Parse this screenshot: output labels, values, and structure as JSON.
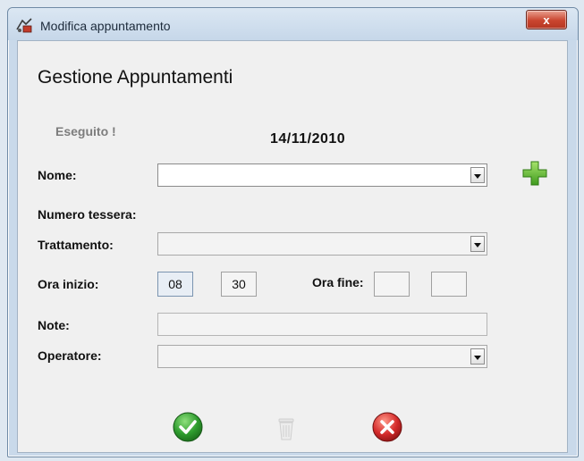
{
  "window": {
    "title": "Modifica appuntamento",
    "close_label": "x"
  },
  "header": {
    "title": "Gestione Appuntamenti"
  },
  "status": {
    "text": "Eseguito !"
  },
  "date": "14/11/2010",
  "form": {
    "nome_label": "Nome:",
    "nome_value": "",
    "numero_tessera_label": "Numero tessera:",
    "trattamento_label": "Trattamento:",
    "trattamento_value": "",
    "ora_inizio_label": "Ora inizio:",
    "ora_inizio_hour": "08",
    "ora_inizio_min": "30",
    "ora_fine_label": "Ora fine:",
    "ora_fine_hour": "",
    "ora_fine_min": "",
    "note_label": "Note:",
    "note_value": "",
    "operatore_label": "Operatore:",
    "operatore_value": ""
  },
  "icons": {
    "add": "plus-icon",
    "confirm": "check-icon",
    "delete": "trash-icon",
    "cancel": "close-icon"
  },
  "colors": {
    "confirm": "#2e9b2e",
    "cancel": "#d42a2a",
    "add": "#5cbf2a"
  }
}
